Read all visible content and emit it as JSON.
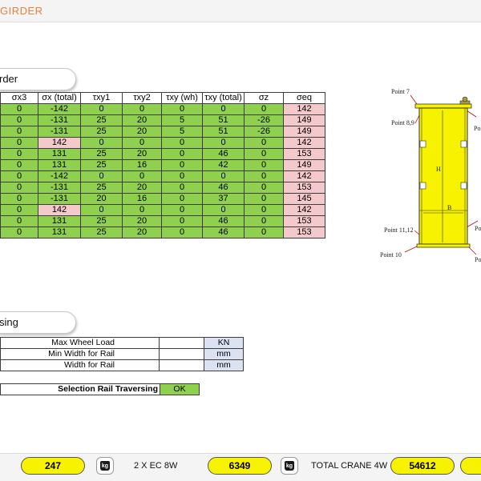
{
  "header": {
    "title": "GIRDER"
  },
  "section1": {
    "title": "rder"
  },
  "table": {
    "headers": [
      "σx3",
      "σx (total)",
      "τxy1",
      "τxy2",
      "τxy (wh)",
      "τxy (total)",
      "σz",
      "σeq"
    ],
    "rows": [
      [
        "0",
        "-142",
        "0",
        "0",
        "0",
        "0",
        "0",
        "142"
      ],
      [
        "0",
        "-131",
        "25",
        "20",
        "5",
        "51",
        "-26",
        "149"
      ],
      [
        "0",
        "-131",
        "25",
        "20",
        "5",
        "51",
        "-26",
        "149"
      ],
      [
        "0",
        "142",
        "0",
        "0",
        "0",
        "0",
        "0",
        "142"
      ],
      [
        "0",
        "131",
        "25",
        "20",
        "0",
        "46",
        "0",
        "153"
      ],
      [
        "0",
        "131",
        "25",
        "16",
        "0",
        "42",
        "0",
        "149"
      ],
      [
        "0",
        "-142",
        "0",
        "0",
        "0",
        "0",
        "0",
        "142"
      ],
      [
        "0",
        "-131",
        "25",
        "20",
        "0",
        "46",
        "0",
        "153"
      ],
      [
        "0",
        "-131",
        "20",
        "16",
        "0",
        "37",
        "0",
        "145"
      ],
      [
        "0",
        "142",
        "0",
        "0",
        "0",
        "0",
        "0",
        "142"
      ],
      [
        "0",
        "131",
        "25",
        "20",
        "0",
        "46",
        "0",
        "153"
      ],
      [
        "0",
        "131",
        "25",
        "20",
        "0",
        "46",
        "0",
        "153"
      ]
    ],
    "pink_cells": [
      [
        3,
        1
      ],
      [
        9,
        1
      ]
    ]
  },
  "diagram": {
    "point7": "Point 7",
    "point89": "Point 8,9",
    "point1112": "Point 11,12",
    "point10": "Point 10",
    "H": "H",
    "B": "B",
    "right1": "Poi",
    "right2": "Po",
    "right3": "Po"
  },
  "section2": {
    "title": "sing"
  },
  "rail": {
    "rows": [
      {
        "label": "Max Wheel Load",
        "unit": "KN"
      },
      {
        "label": "Min Width for Rail",
        "unit": "mm"
      },
      {
        "label": "Width for Rail",
        "unit": "mm"
      }
    ],
    "selection_label": "Selection Rail Traversing",
    "selection_value": "OK"
  },
  "bottom": {
    "value1": "247",
    "label2": "2 X EC 8W",
    "value2": "6349",
    "label3": "TOTAL CRANE 4W",
    "value3": "54612",
    "kg_text": "kg"
  },
  "colors": {
    "green": "#8fd14f",
    "pink": "#f3c9cc",
    "yellow": "#f7f200",
    "accent": "#e8823a"
  }
}
